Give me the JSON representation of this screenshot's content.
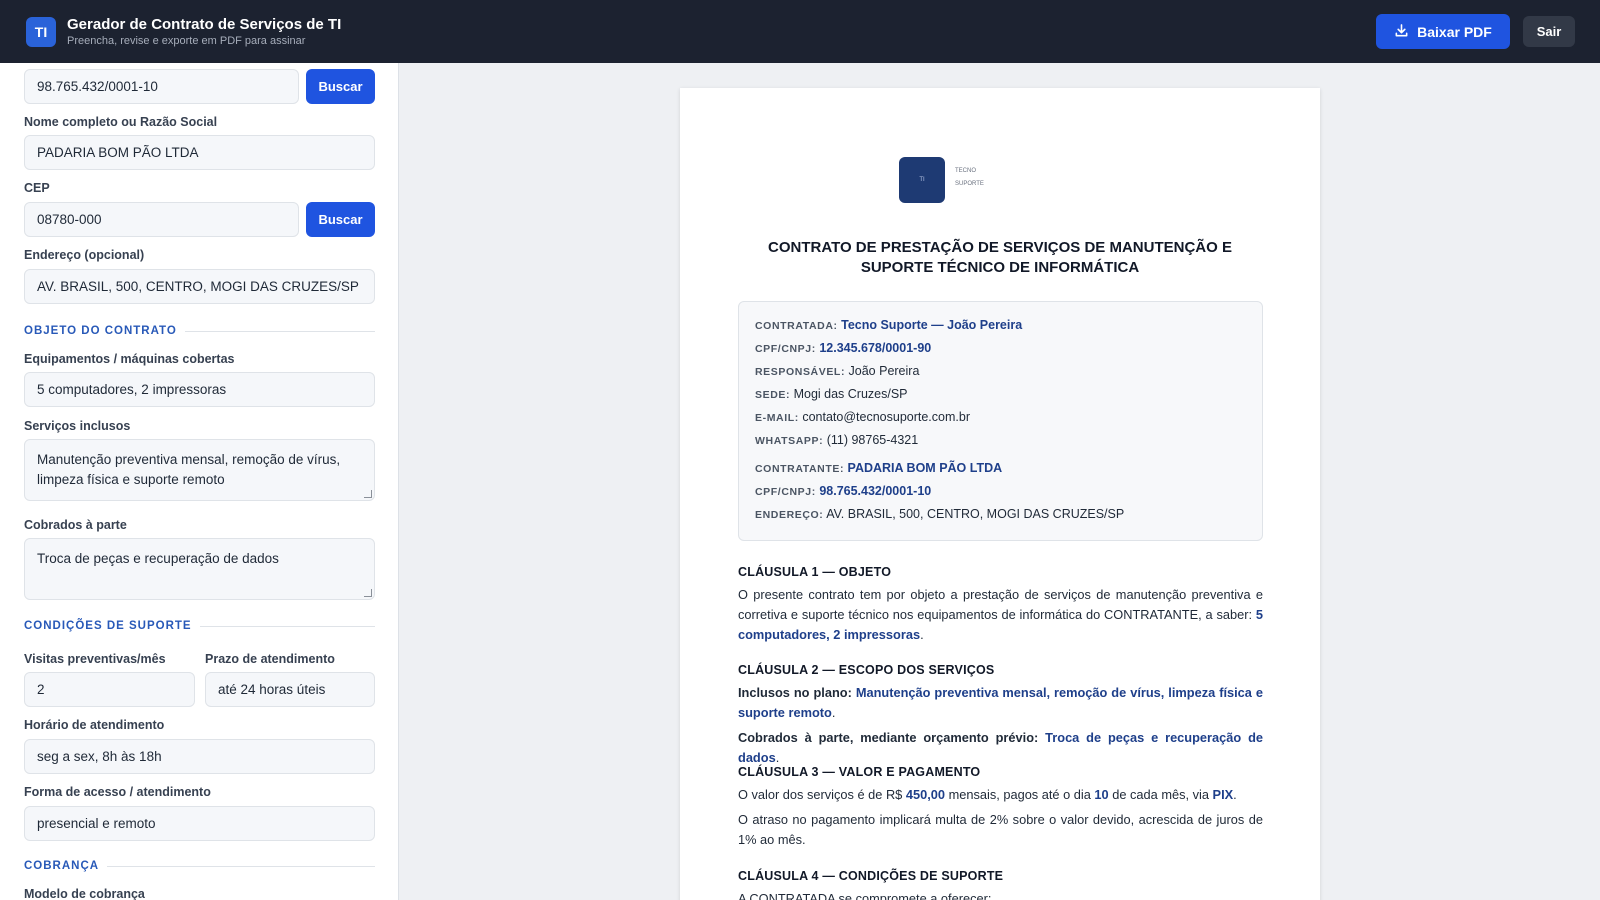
{
  "header": {
    "logo_text": "TI",
    "title": "Gerador de Contrato de Serviços de TI",
    "subtitle": "Preencha, revise e exporte em PDF para assinar",
    "download_label": "Baixar PDF",
    "exit_label": "Sair"
  },
  "form": {
    "cpf_value": "98.765.432/0001-10",
    "search_label": "Buscar",
    "name_label": "Nome completo ou Razão Social",
    "name_value": "PADARIA BOM PÃO LTDA",
    "cep_label": "CEP",
    "cep_value": "08780-000",
    "address_label": "Endereço (opcional)",
    "address_value": "AV. BRASIL, 500, CENTRO, MOGI DAS CRUZES/SP",
    "section_object": "OBJETO DO CONTRATO",
    "equipment_label": "Equipamentos / máquinas cobertas",
    "equipment_value": "5 computadores, 2 impressoras",
    "services_label": "Serviços inclusos",
    "services_value": "Manutenção preventiva mensal, remoção de vírus, limpeza física e suporte remoto",
    "extra_label": "Cobrados à parte",
    "extra_value": "Troca de peças e recuperação de dados",
    "section_support": "CONDIÇÕES DE SUPORTE",
    "visits_label": "Visitas preventivas/mês",
    "visits_value": "2",
    "deadline_label": "Prazo de atendimento",
    "deadline_value": "até 24 horas úteis",
    "hours_label": "Horário de atendimento",
    "hours_value": "seg a sex, 8h às 18h",
    "access_label": "Forma de acesso / atendimento",
    "access_value": "presencial e remoto",
    "section_billing": "COBRANÇA",
    "billing_model_label": "Modelo de cobrança"
  },
  "document": {
    "logo_mark": "TI",
    "logo_line1": "TECNO",
    "logo_line2": "SUPORTE",
    "title": "CONTRATO DE PRESTAÇÃO DE SERVIÇOS DE MANUTENÇÃO E SUPORTE TÉCNICO DE INFORMÁTICA",
    "parties": {
      "contratada_key": "CONTRATADA:",
      "contratada_value": "Tecno Suporte — João Pereira",
      "cpf1_key": "CPF/CNPJ:",
      "cpf1_value": "12.345.678/0001-90",
      "resp_key": "RESPONSÁVEL:",
      "resp_value": "João Pereira",
      "sede_key": "SEDE:",
      "sede_value": "Mogi das Cruzes/SP",
      "email_key": "E-MAIL:",
      "email_value": "contato@tecnosuporte.com.br",
      "whats_key": "WHATSAPP:",
      "whats_value": "(11) 98765-4321",
      "contratante_key": "CONTRATANTE:",
      "contratante_value": "PADARIA BOM PÃO LTDA",
      "cpf2_key": "CPF/CNPJ:",
      "cpf2_value": "98.765.432/0001-10",
      "end_key": "ENDEREÇO:",
      "end_value": "AV. BRASIL, 500, CENTRO, MOGI DAS CRUZES/SP"
    },
    "c1_title": "CLÁUSULA 1 — OBJETO",
    "c1_text": "O presente contrato tem por objeto a prestação de serviços de manutenção preventiva e corretiva e suporte técnico nos equipamentos de informática do CONTRATANTE, a saber:",
    "c1_highlight": "5 computadores, 2 impressoras",
    "c2_title": "CLÁUSULA 2 — ESCOPO DOS SERVIÇOS",
    "c2_included_key": "Inclusos no plano:",
    "c2_included_value": "Manutenção preventiva mensal, remoção de vírus, limpeza física e suporte remoto",
    "c2_extra_key": "Cobrados à parte, mediante orçamento prévio:",
    "c2_extra_value": "Troca de peças e recuperação de dados",
    "c3_title": "CLÁUSULA 3 — VALOR E PAGAMENTO",
    "c3_p1_a": "O valor dos serviços é de R$",
    "c3_value": "450,00",
    "c3_p1_b": "mensais, pagos até o dia",
    "c3_day": "10",
    "c3_p1_c": "de cada mês, via",
    "c3_method": "PIX",
    "c3_p2": "O atraso no pagamento implicará multa de 2% sobre o valor devido, acrescida de juros de 1% ao mês.",
    "c4_title": "CLÁUSULA 4 — CONDIÇÕES DE SUPORTE",
    "c4_text": "A CONTRATADA se compromete a oferecer:"
  }
}
